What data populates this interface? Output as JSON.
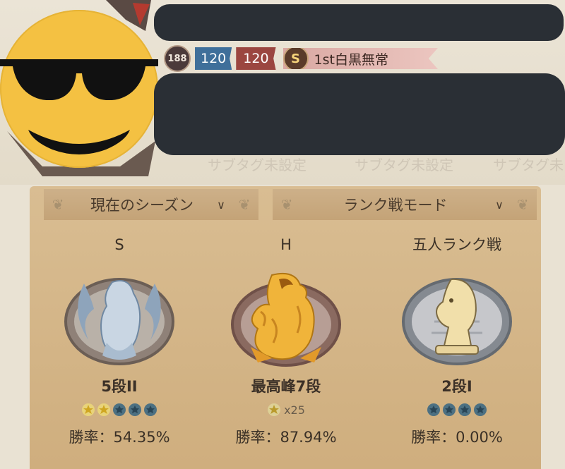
{
  "profile": {
    "level": "188",
    "blue_badge": "120",
    "red_badge": "120",
    "title_icon": "S",
    "title": "1st白黒無常",
    "subtags": [
      "サブタグ未設定",
      "サブタグ未設定",
      "サブタグ未"
    ]
  },
  "filters": {
    "season": "現在のシーズン",
    "mode": "ランク戦モード"
  },
  "ranks": [
    {
      "header": "S",
      "emblem": "griffin-emblem-icon",
      "rank": "5段II",
      "stars_filled": 2,
      "stars_total": 5,
      "win_rate": "勝率：54.35%"
    },
    {
      "header": "H",
      "emblem": "hydra-emblem-icon",
      "rank": "最高峰7段",
      "star_count": "x25",
      "win_rate": "勝率：87.94%"
    },
    {
      "header": "五人ランク戦",
      "emblem": "knight-emblem-icon",
      "rank": "2段I",
      "stars_filled": 0,
      "stars_total": 4,
      "win_rate": "勝率：0.00%"
    }
  ],
  "colors": {
    "panel": "#d3b386",
    "redaction": "#2a2f35",
    "emoji": "#f4c142",
    "gold": "#e4b021",
    "silver": "#9aa8b6"
  }
}
